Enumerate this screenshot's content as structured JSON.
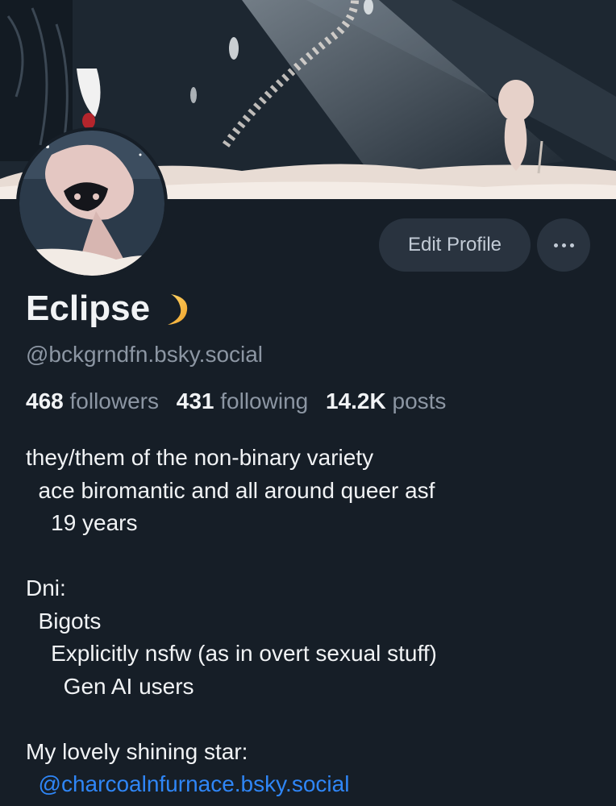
{
  "profile": {
    "display_name": "Eclipse",
    "handle": "@bckgrndfn.bsky.social",
    "followers_count": "468",
    "followers_label": "followers",
    "following_count": "431",
    "following_label": "following",
    "posts_count": "14.2K",
    "posts_label": "posts"
  },
  "actions": {
    "edit_profile_label": "Edit Profile",
    "more_icon": "ellipsis-icon"
  },
  "bio": {
    "lines": [
      "they/them of the non-binary variety",
      "  ace biromantic and all around queer asf",
      "    19 years",
      "",
      "Dni:",
      "  Bigots",
      "    Explicitly nsfw (as in overt sexual stuff)",
      "      Gen AI users",
      "",
      "My lovely shining star:"
    ],
    "mention": "  @charcoalnfurnace.bsky.social"
  },
  "icons": {
    "name_emoji": "crescent-moon-icon"
  },
  "colors": {
    "background": "#161e27",
    "button_bg": "#29333f",
    "link": "#2f86f7",
    "muted_text": "#8c96a3"
  }
}
